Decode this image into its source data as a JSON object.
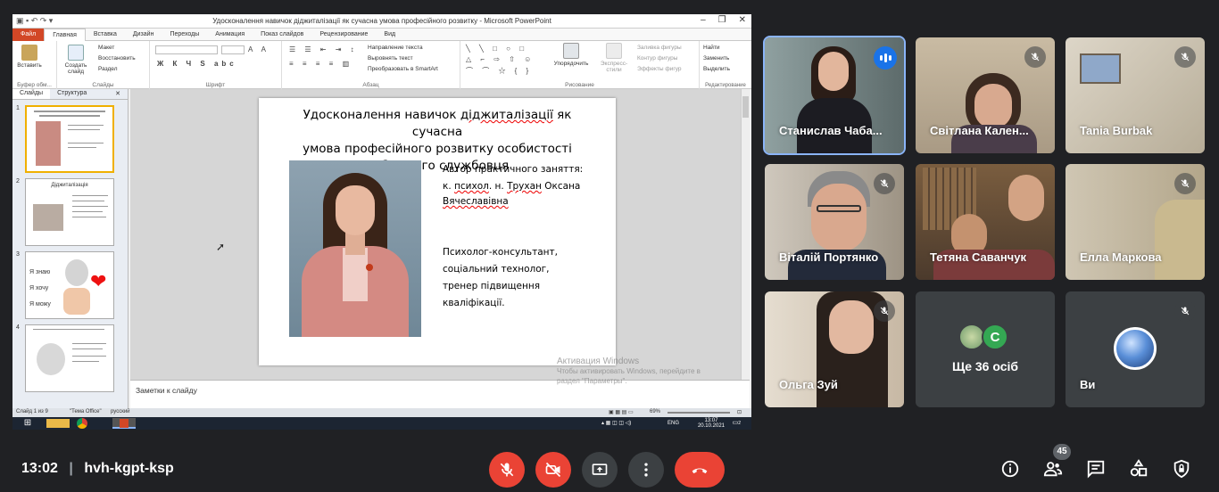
{
  "meeting": {
    "time": "13:02",
    "code": "hvh-kgpt-ksp",
    "participant_count": "45"
  },
  "ppt": {
    "window_title": "Удосконалення навичок діджиталізації як сучасна умова професійного розвитку - Microsoft PowerPoint",
    "tabs": [
      "Файл",
      "Главная",
      "Вставка",
      "Дизайн",
      "Переходы",
      "Анимация",
      "Показ слайдов",
      "Рецензирование",
      "Вид"
    ],
    "active_tab": "Главная",
    "ribbon": {
      "paste": "Вставить",
      "clipboard_group": "Буфер обм...",
      "create_slide": "Создать слайд",
      "layout": "Макет",
      "restore": "Восстановить",
      "section": "Раздел",
      "slides_group": "Слайды",
      "font_group": "Шрифт",
      "text_direction": "Направление текста",
      "align_text": "Выровнять текст",
      "smartart": "Преобразовать в SmartArt",
      "paragraph_group": "Абзац",
      "arrange": "Упорядочить",
      "quick_styles": "Экспресс-стили",
      "shape_fill": "Заливка фигуры",
      "shape_outline": "Контур фигуры",
      "shape_effects": "Эффекты фигур",
      "drawing_group": "Рисование",
      "find": "Найти",
      "replace": "Заменить",
      "select": "Выделить",
      "editing_group": "Редактирование"
    },
    "left_tabs": [
      "Слайды",
      "Структура"
    ],
    "thumbnails": [
      {
        "num": "1",
        "title": "Удосконалення навичок діджиталізації як сучасна умова професійного розвитку"
      },
      {
        "num": "2",
        "title": "Діджиталізація"
      },
      {
        "num": "3",
        "title": "Я знаю / Я хочу / Я можу"
      },
      {
        "num": "4",
        "title": ""
      }
    ],
    "slide": {
      "title_lines": [
        "Удосконалення навичок ",
        "діджиталізації",
        " як сучасна",
        "умова професійного розвитку особистості",
        "публічного службовця"
      ],
      "author_label": "Автор практичного заняття:",
      "author_line2_a": "к. ",
      "author_line2_b": "психол",
      "author_line2_c": ". н. ",
      "author_line2_d": "Трухан",
      "author_line2_e": " Оксана",
      "author_line3": "Вячеславівна",
      "role_lines": [
        "Психолог-консультант,",
        "соціальний технолог,",
        "тренер підвищення",
        "кваліфікації."
      ]
    },
    "notes_placeholder": "Заметки к слайду",
    "activation": {
      "title": "Активация Windows",
      "line1": "Чтобы активировать Windows, перейдите в",
      "line2": "раздел \"Параметры\"."
    },
    "status": {
      "slide_of": "Слайд 1 из 9",
      "theme": "\"Тема Office\"",
      "language": "русский",
      "zoom": "69%"
    },
    "taskbar": {
      "lang": "ENG",
      "clock_time": "13:07",
      "clock_date": "20.10.2021",
      "notif_count": "2"
    }
  },
  "participants": [
    {
      "name": "Станислав Чаба...",
      "state": "speaking"
    },
    {
      "name": "Світлана Кален...",
      "state": "muted"
    },
    {
      "name": "Tania Burbak",
      "state": "muted"
    },
    {
      "name": "Віталій Портянко",
      "state": "muted"
    },
    {
      "name": "Тетяна Саванчук",
      "state": "unmuted"
    },
    {
      "name": "Елла Маркова",
      "state": "muted"
    },
    {
      "name": "Ольга Зуй",
      "state": "muted"
    }
  ],
  "more_participants": {
    "text": "Ще 36 осіб",
    "avatar_letter": "C"
  },
  "self_tile": {
    "name": "Ви"
  },
  "colors": {
    "accent_red": "#ea4335",
    "speaking_blue": "#1a73e8",
    "tile_bg": "#3c4043",
    "bg": "#202124"
  }
}
